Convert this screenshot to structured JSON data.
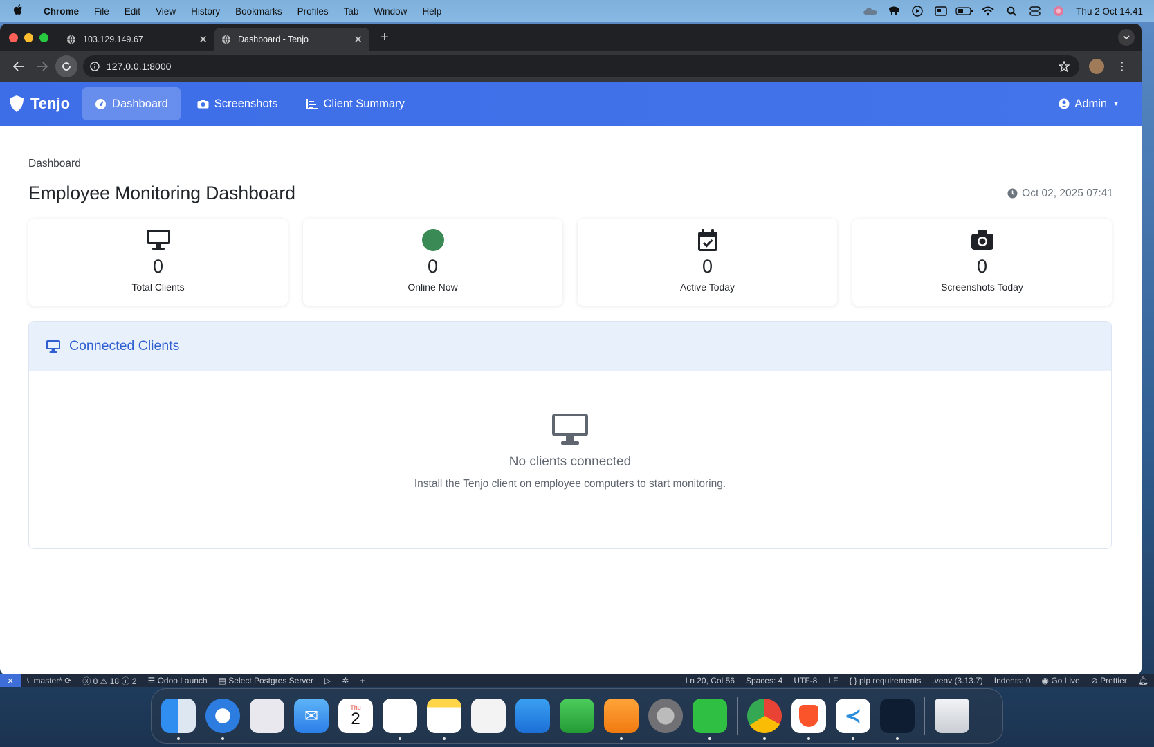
{
  "menubar": {
    "app": "Chrome",
    "items": [
      "File",
      "Edit",
      "View",
      "History",
      "Bookmarks",
      "Profiles",
      "Tab",
      "Window",
      "Help"
    ],
    "clock": "Thu 2 Oct  14.41"
  },
  "browser": {
    "tabs": [
      {
        "title": "103.129.149.67",
        "active": false
      },
      {
        "title": "Dashboard - Tenjo",
        "active": true
      }
    ],
    "url": "127.0.0.1:8000"
  },
  "navbar": {
    "brand": "Tenjo",
    "links": [
      {
        "label": "Dashboard",
        "icon": "gauge-icon",
        "active": true
      },
      {
        "label": "Screenshots",
        "icon": "camera-icon",
        "active": false
      },
      {
        "label": "Client Summary",
        "icon": "chart-line-icon",
        "active": false
      }
    ],
    "user": "Admin"
  },
  "page": {
    "breadcrumb": "Dashboard",
    "title": "Employee Monitoring Dashboard",
    "timestamp": "Oct 02, 2025 07:41"
  },
  "stats": [
    {
      "value": "0",
      "label": "Total Clients",
      "icon": "desktop-icon"
    },
    {
      "value": "0",
      "label": "Online Now",
      "icon": "online-dot-icon",
      "color": "#3a8a55"
    },
    {
      "value": "0",
      "label": "Active Today",
      "icon": "calendar-check-icon"
    },
    {
      "value": "0",
      "label": "Screenshots Today",
      "icon": "camera-icon"
    }
  ],
  "clients": {
    "header": "Connected Clients",
    "empty_title": "No clients connected",
    "empty_subtitle": "Install the Tenjo client on employee computers to start monitoring."
  },
  "statusbar": {
    "branch": "master*",
    "problems": "0",
    "warnings": "18",
    "info": "2",
    "items_left": [
      "Odoo Launch",
      "Select Postgres Server"
    ],
    "cursor": "Ln 20, Col 56",
    "spaces": "Spaces: 4",
    "encoding": "UTF-8",
    "eol": "LF",
    "language": "pip requirements",
    "venv": ".venv (3.13.7)",
    "indents": "Indents: 0",
    "golive": "Go Live",
    "prettier": "Prettier"
  },
  "dock": {
    "apps": [
      "Finder",
      "Safari",
      "Launchpad",
      "Mail",
      "Calendar",
      "Reminders",
      "Notes",
      "Freeform",
      "Keynote",
      "Numbers",
      "Pages",
      "System Settings",
      "WhatsApp",
      "Chrome",
      "Brave",
      "VS Code",
      "Cloud App",
      "Trash"
    ],
    "calendar_day": "Thu",
    "calendar_date": "2"
  },
  "colors": {
    "nav_blue": "#3d6ee8",
    "header_blue": "#2f5fd0",
    "online_green": "#3a8a55"
  }
}
